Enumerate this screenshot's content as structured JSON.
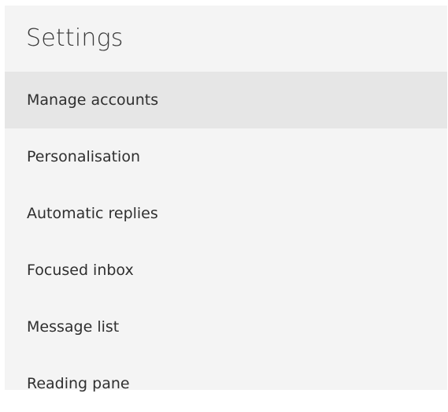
{
  "settings": {
    "title": "Settings",
    "items": [
      {
        "label": "Manage accounts",
        "selected": true
      },
      {
        "label": "Personalisation",
        "selected": false
      },
      {
        "label": "Automatic replies",
        "selected": false
      },
      {
        "label": "Focused inbox",
        "selected": false
      },
      {
        "label": "Message list",
        "selected": false
      },
      {
        "label": "Reading pane",
        "selected": false
      }
    ]
  }
}
